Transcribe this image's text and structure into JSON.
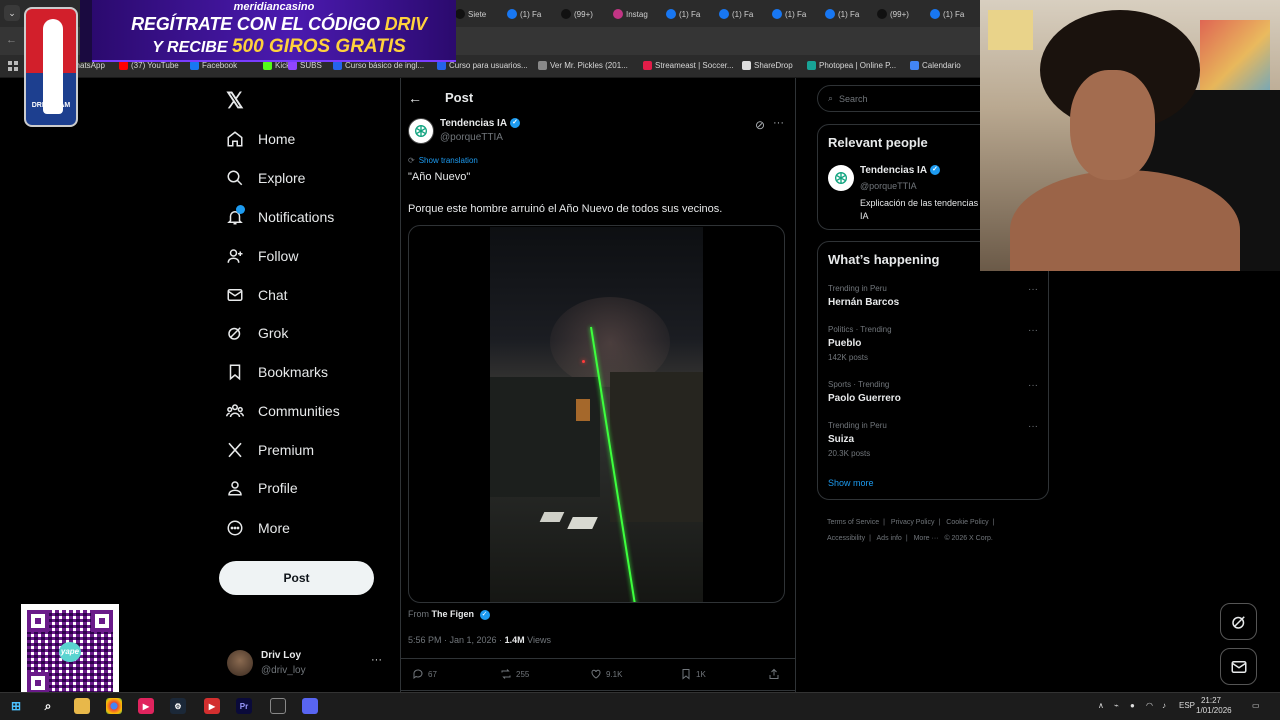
{
  "browser": {
    "tabs": [
      {
        "label": "Siete",
        "icon": "tiktok-icon",
        "color": "#111111"
      },
      {
        "label": "(1) Fa",
        "icon": "facebook-icon",
        "color": "#1877f2"
      },
      {
        "label": "(99+)",
        "icon": "tiktok-icon",
        "color": "#111111"
      },
      {
        "label": "Instag",
        "icon": "instagram-icon",
        "color": "#c13584"
      },
      {
        "label": "(1) Fa",
        "icon": "facebook-icon",
        "color": "#1877f2"
      },
      {
        "label": "(1) Fa",
        "icon": "facebook-icon",
        "color": "#1877f2"
      },
      {
        "label": "(1) Fa",
        "icon": "facebook-icon",
        "color": "#1877f2"
      },
      {
        "label": "(1) Fa",
        "icon": "facebook-icon",
        "color": "#1877f2"
      },
      {
        "label": "(99+)",
        "icon": "tiktok-icon",
        "color": "#111111"
      },
      {
        "label": "(1) Fa",
        "icon": "facebook-icon",
        "color": "#1877f2"
      }
    ],
    "bookmarks": [
      {
        "label": "WhatsApp",
        "color": "#25d366"
      },
      {
        "label": "(37) YouTube",
        "color": "#ff0000"
      },
      {
        "label": "Facebook",
        "color": "#1877f2"
      },
      {
        "label": "Kick",
        "color": "#53fc18"
      },
      {
        "label": "SUBS",
        "color": "#9146ff"
      },
      {
        "label": "Curso básico de ingl...",
        "color": "#2563eb"
      },
      {
        "label": "Curso para usuarios...",
        "color": "#2563eb"
      },
      {
        "label": "Ver Mr. Pickles (201...",
        "color": "#888888"
      },
      {
        "label": "Streameast | Soccer...",
        "color": "#e11d48"
      },
      {
        "label": "ShareDrop",
        "color": "#dddddd"
      },
      {
        "label": "Photopea | Online P...",
        "color": "#18a497"
      },
      {
        "label": "Calendario",
        "color": "#4285f4"
      }
    ]
  },
  "ad": {
    "brand": "meridiancasino",
    "line1": "REGÍTRATE CON EL CÓDIGO",
    "code": "DRIV",
    "line2": "Y RECIBE",
    "offer": "500 GIROS GRATIS"
  },
  "team_logo": {
    "text": "DRIV TEAM"
  },
  "nav": {
    "items": [
      {
        "label": "Home",
        "icon": "home-icon"
      },
      {
        "label": "Explore",
        "icon": "search-icon"
      },
      {
        "label": "Notifications",
        "icon": "bell-icon"
      },
      {
        "label": "Follow",
        "icon": "follow-icon"
      },
      {
        "label": "Chat",
        "icon": "mail-icon"
      },
      {
        "label": "Grok",
        "icon": "grok-icon"
      },
      {
        "label": "Bookmarks",
        "icon": "bookmark-icon"
      },
      {
        "label": "Communities",
        "icon": "communities-icon"
      },
      {
        "label": "Premium",
        "icon": "x-premium-icon"
      },
      {
        "label": "Profile",
        "icon": "profile-icon"
      },
      {
        "label": "More",
        "icon": "more-icon"
      }
    ],
    "post_button": "Post",
    "account": {
      "name": "Driv Loy",
      "handle": "@driv_loy"
    }
  },
  "qr": {
    "label": "yape"
  },
  "post": {
    "header": "Post",
    "author": {
      "name": "Tendencias IA",
      "handle": "@porqueTTIA"
    },
    "show_translation": "Show translation",
    "title": "\"Año Nuevo\"",
    "body": "Porque este hombre arruinó el Año Nuevo de todos sus vecinos.",
    "from_label": "From",
    "from_source": "The Figen",
    "timestamp": "5:56 PM · Jan 1, 2026 ·",
    "views_count": "1.4M",
    "views_label": "Views",
    "actions": {
      "replies": "67",
      "reposts": "255",
      "likes": "9.1K",
      "bookmarks": "1K"
    }
  },
  "sidebar": {
    "search_placeholder": "Search",
    "relevant_people": {
      "title": "Relevant people",
      "name": "Tendencias IA",
      "handle": "@porqueTTIA",
      "bio": "Explicación de las tendencias de Twitter con IA"
    },
    "whats_happening": {
      "title": "What’s happening",
      "trends": [
        {
          "context": "Trending in Peru",
          "name": "Hernán Barcos",
          "count": ""
        },
        {
          "context": "Politics · Trending",
          "name": "Pueblo",
          "count": "142K posts"
        },
        {
          "context": "Sports · Trending",
          "name": "Paolo Guerrero",
          "count": ""
        },
        {
          "context": "Trending in Peru",
          "name": "Suiza",
          "count": "20.3K posts"
        }
      ],
      "show_more": "Show more"
    },
    "footer": {
      "links": [
        "Terms of Service",
        "Privacy Policy",
        "Cookie Policy",
        "Accessibility",
        "Ads info",
        "More ···"
      ],
      "copyright": "© 2026 X Corp."
    }
  },
  "taskbar": {
    "language": "ESP",
    "time": "21:27",
    "date": "1/01/2026"
  },
  "colors": {
    "accent": "#1d9bf0",
    "background": "#000000",
    "laser": "#3dff3d"
  }
}
